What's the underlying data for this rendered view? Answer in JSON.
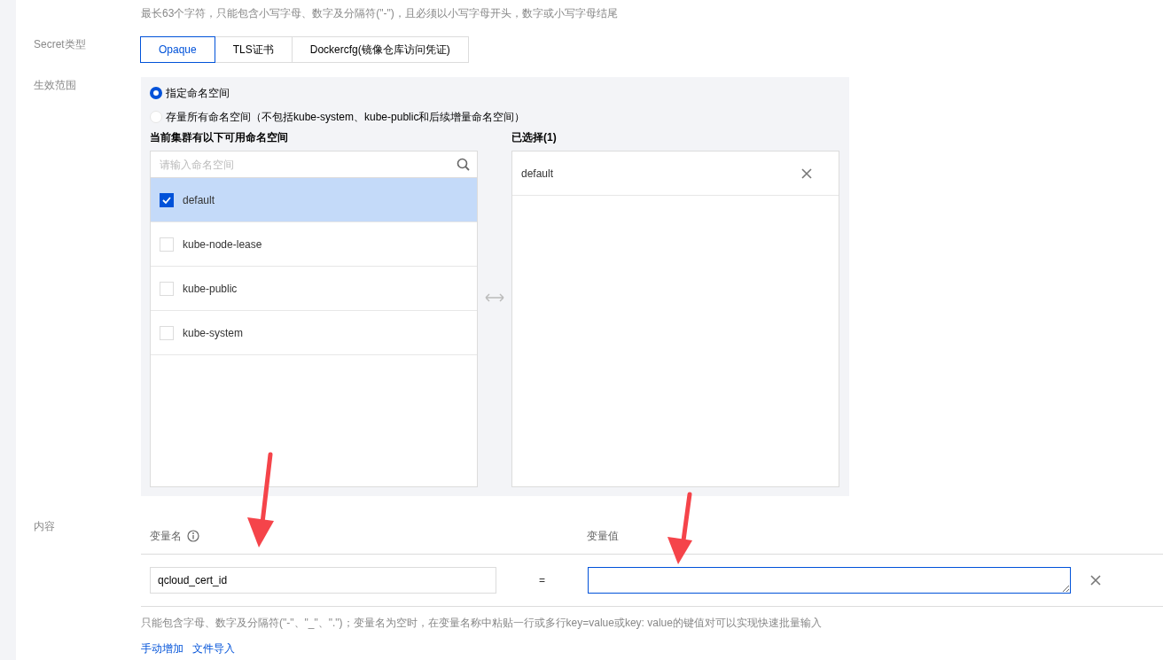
{
  "name_hint": "最长63个字符，只能包含小写字母、数字及分隔符(\"-\")，且必须以小写字母开头，数字或小写字母结尾",
  "secret_type": {
    "label": "Secret类型",
    "options": [
      {
        "label": "Opaque",
        "selected": true
      },
      {
        "label": "TLS证书",
        "selected": false
      },
      {
        "label": "Dockercfg(镜像仓库访问凭证)",
        "selected": false
      }
    ]
  },
  "scope": {
    "label": "生效范围",
    "options": [
      {
        "label": "指定命名空间",
        "selected": true
      },
      {
        "label": "存量所有命名空间（不包括kube-system、kube-public和后续增量命名空间）",
        "selected": false
      }
    ],
    "available": {
      "title": "当前集群有以下可用命名空间",
      "search": {
        "placeholder": "请输入命名空间"
      },
      "items": [
        {
          "label": "default",
          "checked": true
        },
        {
          "label": "kube-node-lease",
          "checked": false
        },
        {
          "label": "kube-public",
          "checked": false
        },
        {
          "label": "kube-system",
          "checked": false
        }
      ]
    },
    "chosen": {
      "title": "已选择(1)",
      "items": [
        {
          "label": "default"
        }
      ]
    }
  },
  "content": {
    "label": "内容",
    "columns": [
      {
        "label": "变量名",
        "info": true
      },
      {
        "label": "变量值",
        "info": false
      }
    ],
    "rows": [
      {
        "name": "qcloud_cert_id",
        "equals": "=",
        "value": "",
        "focused": true
      }
    ],
    "hint": "只能包含字母、数字及分隔符(\"-\"、\"_\"、\".\")；变量名为空时，在变量名称中粘贴一行或多行key=value或key: value的键值对可以实现快速批量输入",
    "links": [
      "手动增加",
      "文件导入"
    ]
  }
}
